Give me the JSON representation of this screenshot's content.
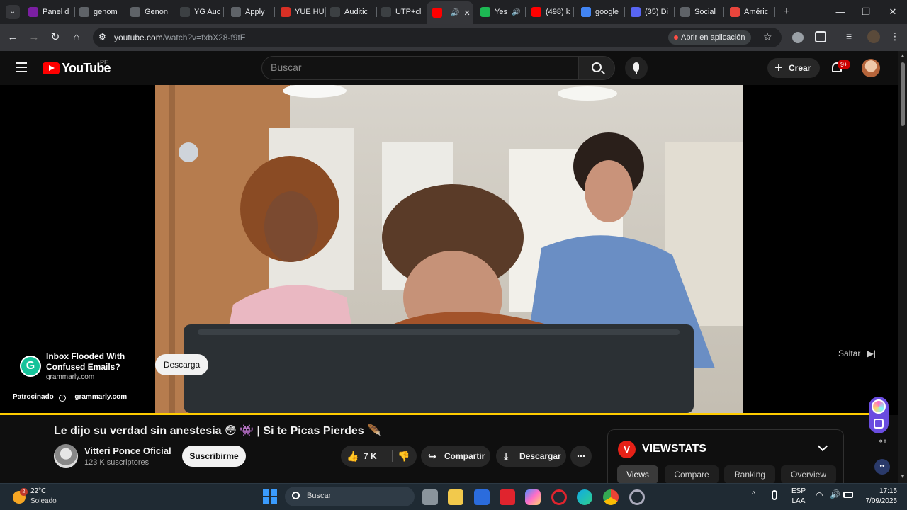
{
  "tabs": [
    {
      "label": "Panel d",
      "color": "#7b1fa2"
    },
    {
      "label": "genom",
      "color": "#5f6368"
    },
    {
      "label": "Genon",
      "color": "#5f6368"
    },
    {
      "label": "YG Auc",
      "color": "#3c4043"
    },
    {
      "label": "Apply",
      "color": "#5f6368"
    },
    {
      "label": "YUE HU",
      "color": "#d93025"
    },
    {
      "label": "Auditic",
      "color": "#3c4043"
    },
    {
      "label": "UTP+cl",
      "color": "#3c4043"
    },
    {
      "label": "",
      "color": "#ff0000"
    },
    {
      "label": "Yes",
      "color": "#1db954"
    },
    {
      "label": "(498) k",
      "color": "#ff0000"
    },
    {
      "label": "google",
      "color": "#4285f4"
    },
    {
      "label": "(35) Di",
      "color": "#5865f2"
    },
    {
      "label": "Social",
      "color": "#5f6368"
    },
    {
      "label": "Améric",
      "color": "#e8453c"
    }
  ],
  "browser": {
    "url_host": "youtube.com",
    "url_path": "/watch?v=fxbX28-f9tE",
    "open_in_app": "Abrir en aplicación"
  },
  "youtube": {
    "logo_text": "YouTube",
    "region": "PE",
    "search_placeholder": "Buscar",
    "create_label": "Crear",
    "notif_count": "9+"
  },
  "ad": {
    "headline_1": "Inbox Flooded With",
    "headline_2": "Confused Emails?",
    "domain": "grammarly.com",
    "download_label": "Descarga",
    "sponsored_label": "Patrocinado",
    "sponsor_domain": "grammarly.com",
    "skip_label": "Saltar"
  },
  "video": {
    "title": "Le dijo su verdad sin anestesia 😳 👾 | Si te Picas Pierdes 🪶",
    "channel": "Vitteri Ponce Oficial",
    "subscribers": "123 K suscriptores",
    "subscribe_label": "Suscribirme",
    "likes": "7 K",
    "share_label": "Compartir",
    "download_label": "Descargar",
    "progress": 0.99
  },
  "viewstats": {
    "title": "VIEWSTATS",
    "tabs": [
      "Views",
      "Compare",
      "Ranking",
      "Overview"
    ]
  },
  "taskbar": {
    "temperature": "22°C",
    "weather": "Soleado",
    "search_placeholder": "Buscar",
    "lang_1": "ESP",
    "lang_2": "LAA",
    "time": "17:15",
    "date": "7/09/2025",
    "weather_badge": "2"
  }
}
